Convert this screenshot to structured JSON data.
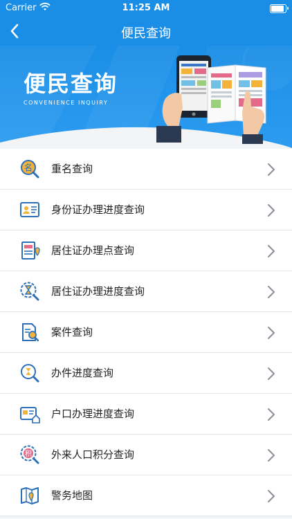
{
  "status": {
    "carrier": "Carrier",
    "time": "11:25 AM"
  },
  "nav": {
    "title": "便民查询"
  },
  "banner": {
    "title": "便民查询",
    "subtitle": "CONVENIENCE INQUIRY"
  },
  "items": [
    {
      "label": "重名查询",
      "icon": "name-search-icon"
    },
    {
      "label": "身份证办理进度查询",
      "icon": "id-card-icon"
    },
    {
      "label": "居住证办理点查询",
      "icon": "residence-permit-office-icon"
    },
    {
      "label": "居住证办理进度查询",
      "icon": "hourglass-search-icon"
    },
    {
      "label": "案件查询",
      "icon": "case-document-icon"
    },
    {
      "label": "办件进度查询",
      "icon": "progress-search-icon"
    },
    {
      "label": "户口办理进度查询",
      "icon": "household-card-icon"
    },
    {
      "label": "外来人口积分查询",
      "icon": "points-search-icon"
    },
    {
      "label": "警务地图",
      "icon": "police-map-icon"
    }
  ],
  "colors": {
    "primary": "#1a8ee6",
    "accent": "#f3b23a",
    "icon": "#2c6fb8"
  }
}
